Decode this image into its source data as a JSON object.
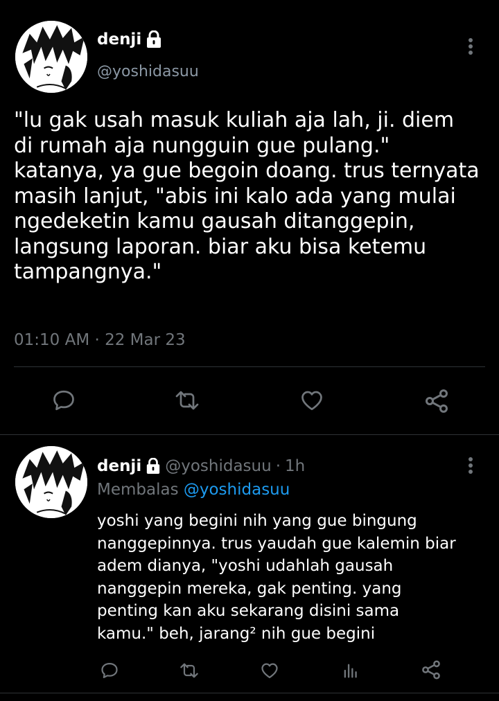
{
  "main_tweet": {
    "display_name": "denji",
    "handle": "@yoshidasuu",
    "text": "\"lu gak usah masuk kuliah aja lah, ji. diem\ndi rumah aja nungguin gue pulang.\"\nkatanya, ya gue begoin doang. trus ternyata\nmasih lanjut, \"abis ini kalo ada yang mulai\nngedeketin kamu gausah ditanggepin,\nlangsung laporan. biar aku bisa ketemu\ntampangnya.\"",
    "timestamp": "01:10 AM · 22 Mar 23",
    "actions": [
      "reply-icon",
      "retweet-icon",
      "like-icon",
      "share-icon"
    ]
  },
  "reply_tweet": {
    "display_name": "denji",
    "handle": "@yoshidasuu",
    "separator": "·",
    "time": "1h",
    "replying_prefix": "Membalas",
    "replying_to": "@yoshidasuu",
    "text": "yoshi yang begini nih yang gue bingung\nnanggepinnya. trus yaudah gue kalemin biar\nadem dianya, \"yoshi udahlah gausah\nnanggepin mereka, gak penting. yang\npenting kan aku sekarang disini sama\nkamu.\" beh, jarang² nih gue begini",
    "actions": [
      "reply-icon",
      "retweet-icon",
      "like-icon",
      "analytics-icon",
      "share-icon"
    ]
  },
  "colors": {
    "background": "#000000",
    "text": "#ffffff",
    "secondary": "#71767b",
    "accent": "#1d9bf0",
    "divider": "#2f3336"
  }
}
